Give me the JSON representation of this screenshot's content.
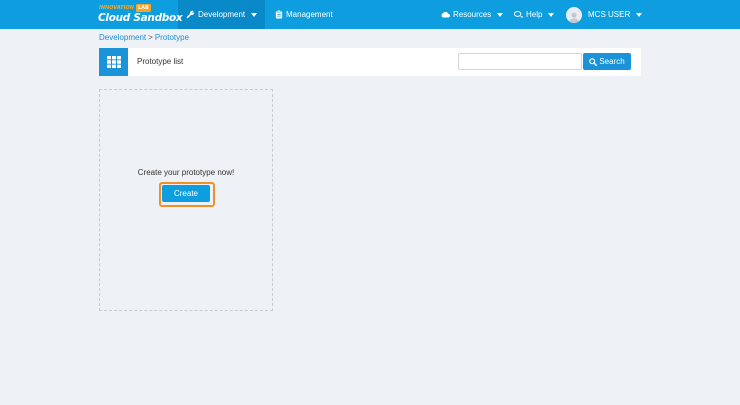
{
  "brand": {
    "tagline": "INNOVATION",
    "badge": "LAB",
    "name": "Cloud Sandbox"
  },
  "nav": {
    "development": "Development",
    "management": "Management",
    "resources": "Resources",
    "help": "Help",
    "user": "MCS USER"
  },
  "breadcrumb": {
    "root": "Development",
    "separator": ">",
    "current": "Prototype"
  },
  "page": {
    "title": "Prototype list"
  },
  "search": {
    "value": "",
    "button_label": "Search"
  },
  "create_card": {
    "prompt": "Create your prototype now!",
    "button_label": "Create"
  },
  "colors": {
    "navbar": "#0e9ee0",
    "navbar_active": "#0a89c8",
    "accent": "#1a93d8",
    "highlight": "#f0902a",
    "page_bg": "#eef1f6"
  },
  "icons": {
    "development": "wrench-icon",
    "management": "clipboard-icon",
    "resources": "cloud-icon",
    "help": "chat-bubbles-icon",
    "page_header": "grid-icon",
    "search": "search-icon"
  }
}
